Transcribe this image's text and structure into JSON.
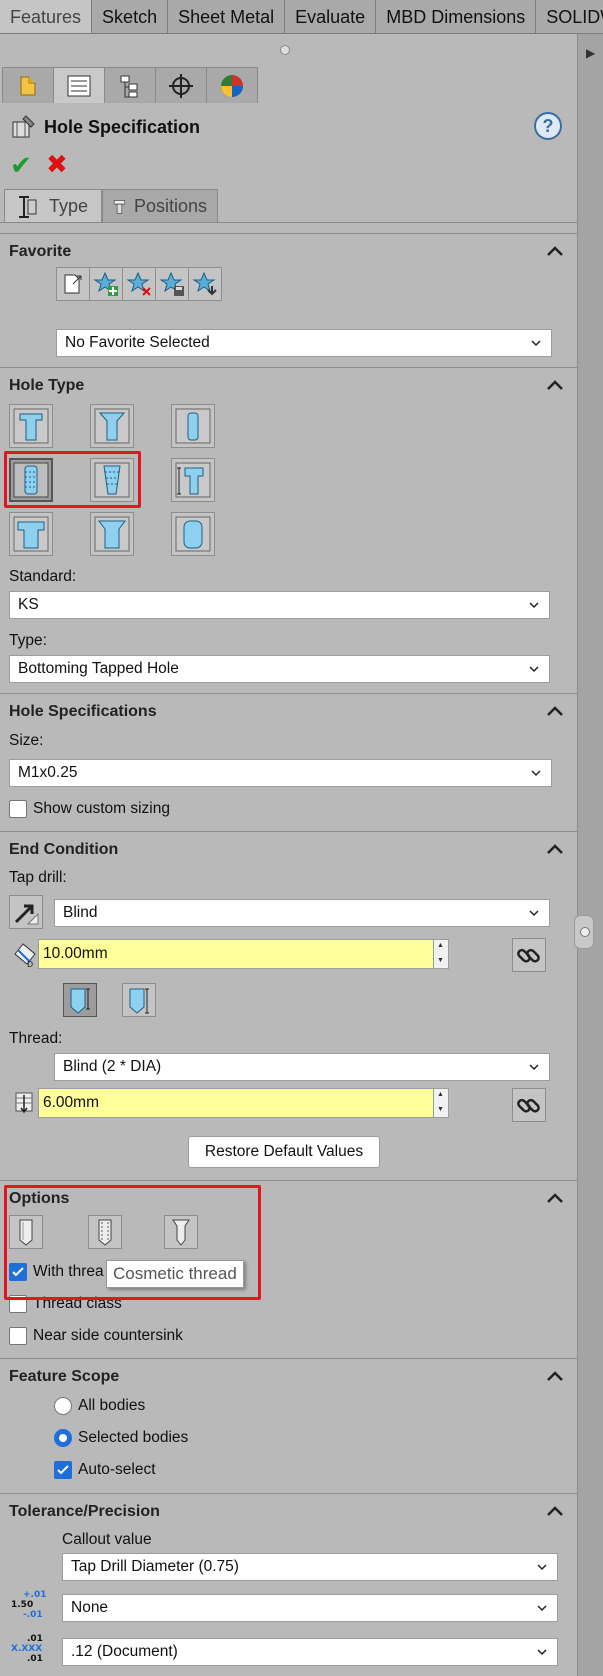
{
  "command_tabs": [
    "Features",
    "Sketch",
    "Sheet Metal",
    "Evaluate",
    "MBD Dimensions",
    "SOLIDWO"
  ],
  "manager_tabs": [
    "feature-manager-icon",
    "property-manager-icon",
    "configuration-manager-icon",
    "dimxpert-manager-icon",
    "display-manager-icon"
  ],
  "header": {
    "title": "Hole Specification",
    "help": "?"
  },
  "sub_tabs": {
    "type": "Type",
    "positions": "Positions"
  },
  "favorite": {
    "title": "Favorite",
    "selected": "No Favorite Selected"
  },
  "hole_type": {
    "title": "Hole Type",
    "standard_label": "Standard:",
    "standard_value": "KS",
    "type_label": "Type:",
    "type_value": "Bottoming Tapped Hole"
  },
  "hole_specs": {
    "title": "Hole Specifications",
    "size_label": "Size:",
    "size_value": "M1x0.25",
    "custom_sizing": "Show custom sizing"
  },
  "end_condition": {
    "title": "End Condition",
    "tap_drill_label": "Tap drill:",
    "tap_drill_value": "Blind",
    "depth_value": "10.00mm",
    "thread_label": "Thread:",
    "thread_value": "Blind (2 * DIA)",
    "thread_depth_value": "6.00mm",
    "restore_label": "Restore Default Values"
  },
  "options": {
    "title": "Options",
    "with_thread": "With threa",
    "tooltip": "Cosmetic thread",
    "thread_class": "Thread class",
    "near_side": "Near side countersink"
  },
  "feature_scope": {
    "title": "Feature Scope",
    "all_bodies": "All bodies",
    "selected_bodies": "Selected bodies",
    "auto_select": "Auto-select"
  },
  "tolerance": {
    "title": "Tolerance/Precision",
    "callout_label": "Callout value",
    "callout_value": "Tap Drill Diameter (0.75)",
    "tolerance_value": "None",
    "precision_value": ".12 (Document)",
    "tol_icon_top": "+.01",
    "tol_icon_mid": "1.50",
    "tol_icon_bot": "-.01",
    "prec_icon_top": ".01",
    "prec_icon_mid": "X.XXX",
    "prec_icon_bot": ".01"
  },
  "colors": {
    "accent": "#1e6fd9",
    "highlight": "#e0171f",
    "input_yellow": "#ffff99",
    "panel": "#b9b9b9"
  }
}
